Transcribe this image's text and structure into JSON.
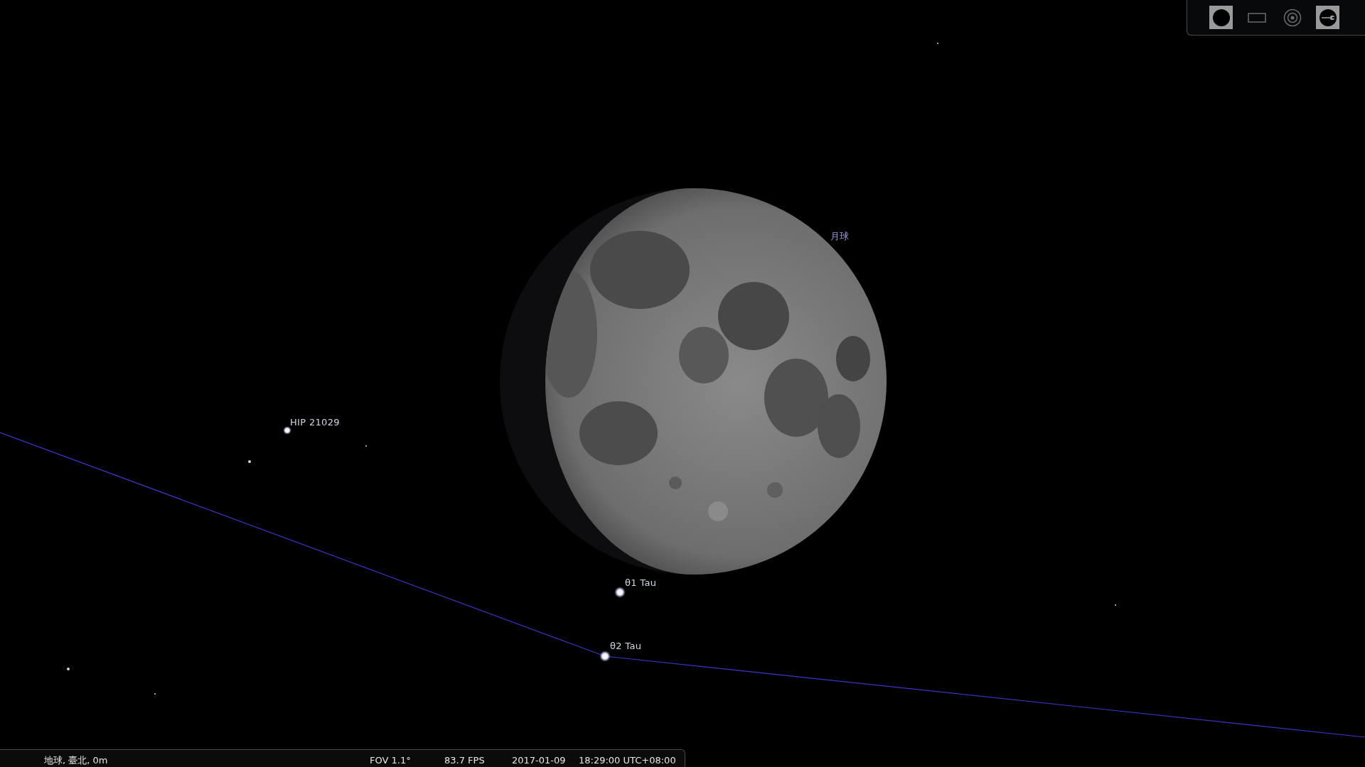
{
  "toolbar": {
    "buttons": [
      {
        "kind": "disk",
        "selected": true
      },
      {
        "kind": "frame",
        "selected": false
      },
      {
        "kind": "target",
        "selected": false
      },
      {
        "kind": "wrench",
        "selected": true
      }
    ]
  },
  "sky": {
    "objects": [
      {
        "label": "月球",
        "kind": "planet"
      },
      {
        "label": "HIP 21029",
        "kind": "star"
      },
      {
        "label": "θ1 Tau",
        "kind": "star"
      },
      {
        "label": "θ2 Tau",
        "kind": "star"
      }
    ]
  },
  "status_bar": {
    "location": "地球, 臺北, 0m",
    "fov": "FOV 1.1°",
    "fps": "83.7 FPS",
    "date": "2017-01-09",
    "time": "18:29:00 UTC+08:00"
  }
}
